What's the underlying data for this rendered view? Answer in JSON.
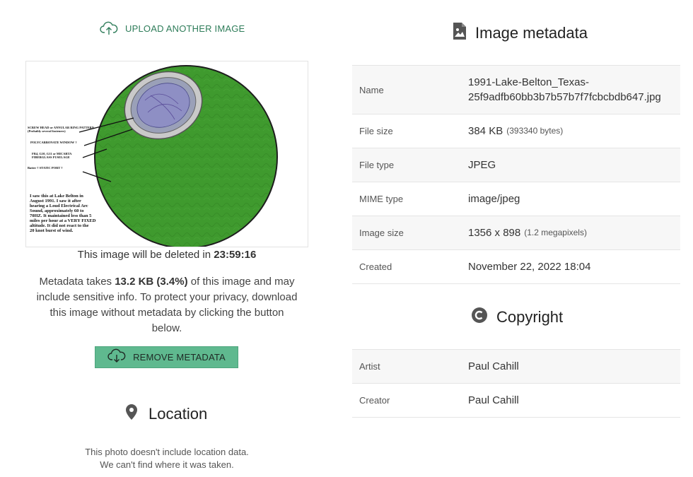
{
  "upload": {
    "label": "UPLOAD ANOTHER IMAGE",
    "icon": "cloud-upload-icon"
  },
  "preview": {
    "annotations": [
      "SCREW HEAD or ANNULAR RING PATTERN",
      "(Probably several fasteners)",
      "POLYCARBONATE WINDOW ?",
      "FR4, G10, G11 or MICARTA",
      "FIBERGLASS FUSELAGE",
      "Batter ?  STATIC PORT ?"
    ],
    "note_lines": [
      "I saw this at Lake Belton in",
      "August 1991.  I saw it after",
      "hearing a Loud Electrical Arc",
      "Sound, approximately 60 to",
      "70HZ.  It maintained less than 5",
      "miles per hour at a VERY FIXED",
      "altitude.  It did not react to the",
      "20 knot burst of wind."
    ]
  },
  "deletion": {
    "prefix": "This image will be deleted in ",
    "countdown": "23:59:16"
  },
  "metadata_note": {
    "prefix": "Metadata takes ",
    "amount": "13.2 KB (3.4%)",
    "suffix": " of this image and may include sensitive info. To protect your privacy, download this image without metadata by clicking the button below."
  },
  "remove_button": {
    "label": "REMOVE METADATA",
    "icon": "cloud-download-icon",
    "color": "#5fb98f"
  },
  "location": {
    "title": "Location",
    "icon": "map-pin-icon",
    "line1": "This photo doesn't include location data.",
    "line2": "We can't find where it was taken."
  },
  "image_metadata": {
    "title": "Image metadata",
    "icon": "file-image-icon",
    "rows": [
      {
        "key": "Name",
        "value_line1": "1991-Lake-Belton_Texas-",
        "value_line2": "25f9adfb60bb3b7b57b7f7fcbcbdb647.jpg"
      },
      {
        "key": "File size",
        "value": "384 KB",
        "detail": "(393340 bytes)"
      },
      {
        "key": "File type",
        "value": "JPEG"
      },
      {
        "key": "MIME type",
        "value": "image/jpeg"
      },
      {
        "key": "Image size",
        "value": "1356 x 898",
        "detail": "(1.2 megapixels)"
      },
      {
        "key": "Created",
        "value": "November 22, 2022 18:04"
      }
    ]
  },
  "copyright": {
    "title": "Copyright",
    "icon": "copyright-icon",
    "rows": [
      {
        "key": "Artist",
        "value": "Paul Cahill"
      },
      {
        "key": "Creator",
        "value": "Paul Cahill"
      }
    ]
  },
  "colors": {
    "accent_green": "#2f7d5a",
    "button_green": "#5fb98f",
    "drawing_green": "#3f9a2e"
  }
}
